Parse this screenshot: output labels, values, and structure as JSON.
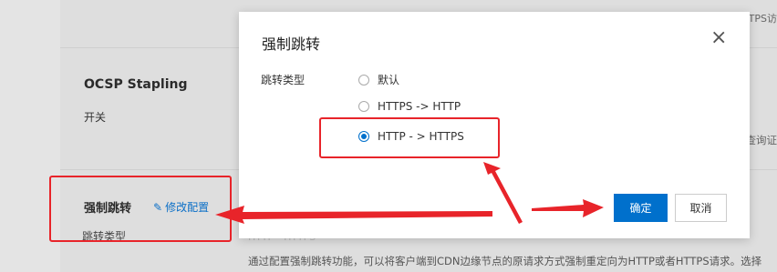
{
  "background": {
    "ocsp": {
      "title": "OCSP Stapling",
      "sub": "开关"
    },
    "force_redirect": {
      "title": "强制跳转",
      "edit_label": "修改配置",
      "sub": "跳转类型",
      "description": "通过配置强制跳转功能，可以将客户端到CDN边缘节点的原请求方式强制重定向为HTTP或者HTTPS请求。选择"
    },
    "fragments": {
      "top_right": "TTPS访",
      "mid_right": "查询证",
      "faded_label": "HTTP - HTTPS"
    }
  },
  "modal": {
    "title": "强制跳转",
    "close_icon": "×",
    "field_label": "跳转类型",
    "options": [
      {
        "label": "默认",
        "checked": false
      },
      {
        "label": "HTTPS -> HTTP",
        "checked": false
      },
      {
        "label": "HTTP - > HTTPS",
        "checked": true
      }
    ],
    "ok_label": "确定",
    "cancel_label": "取消"
  },
  "colors": {
    "primary": "#0070cc",
    "annotation_red": "#e8242a",
    "link": "#0b6fc7"
  }
}
